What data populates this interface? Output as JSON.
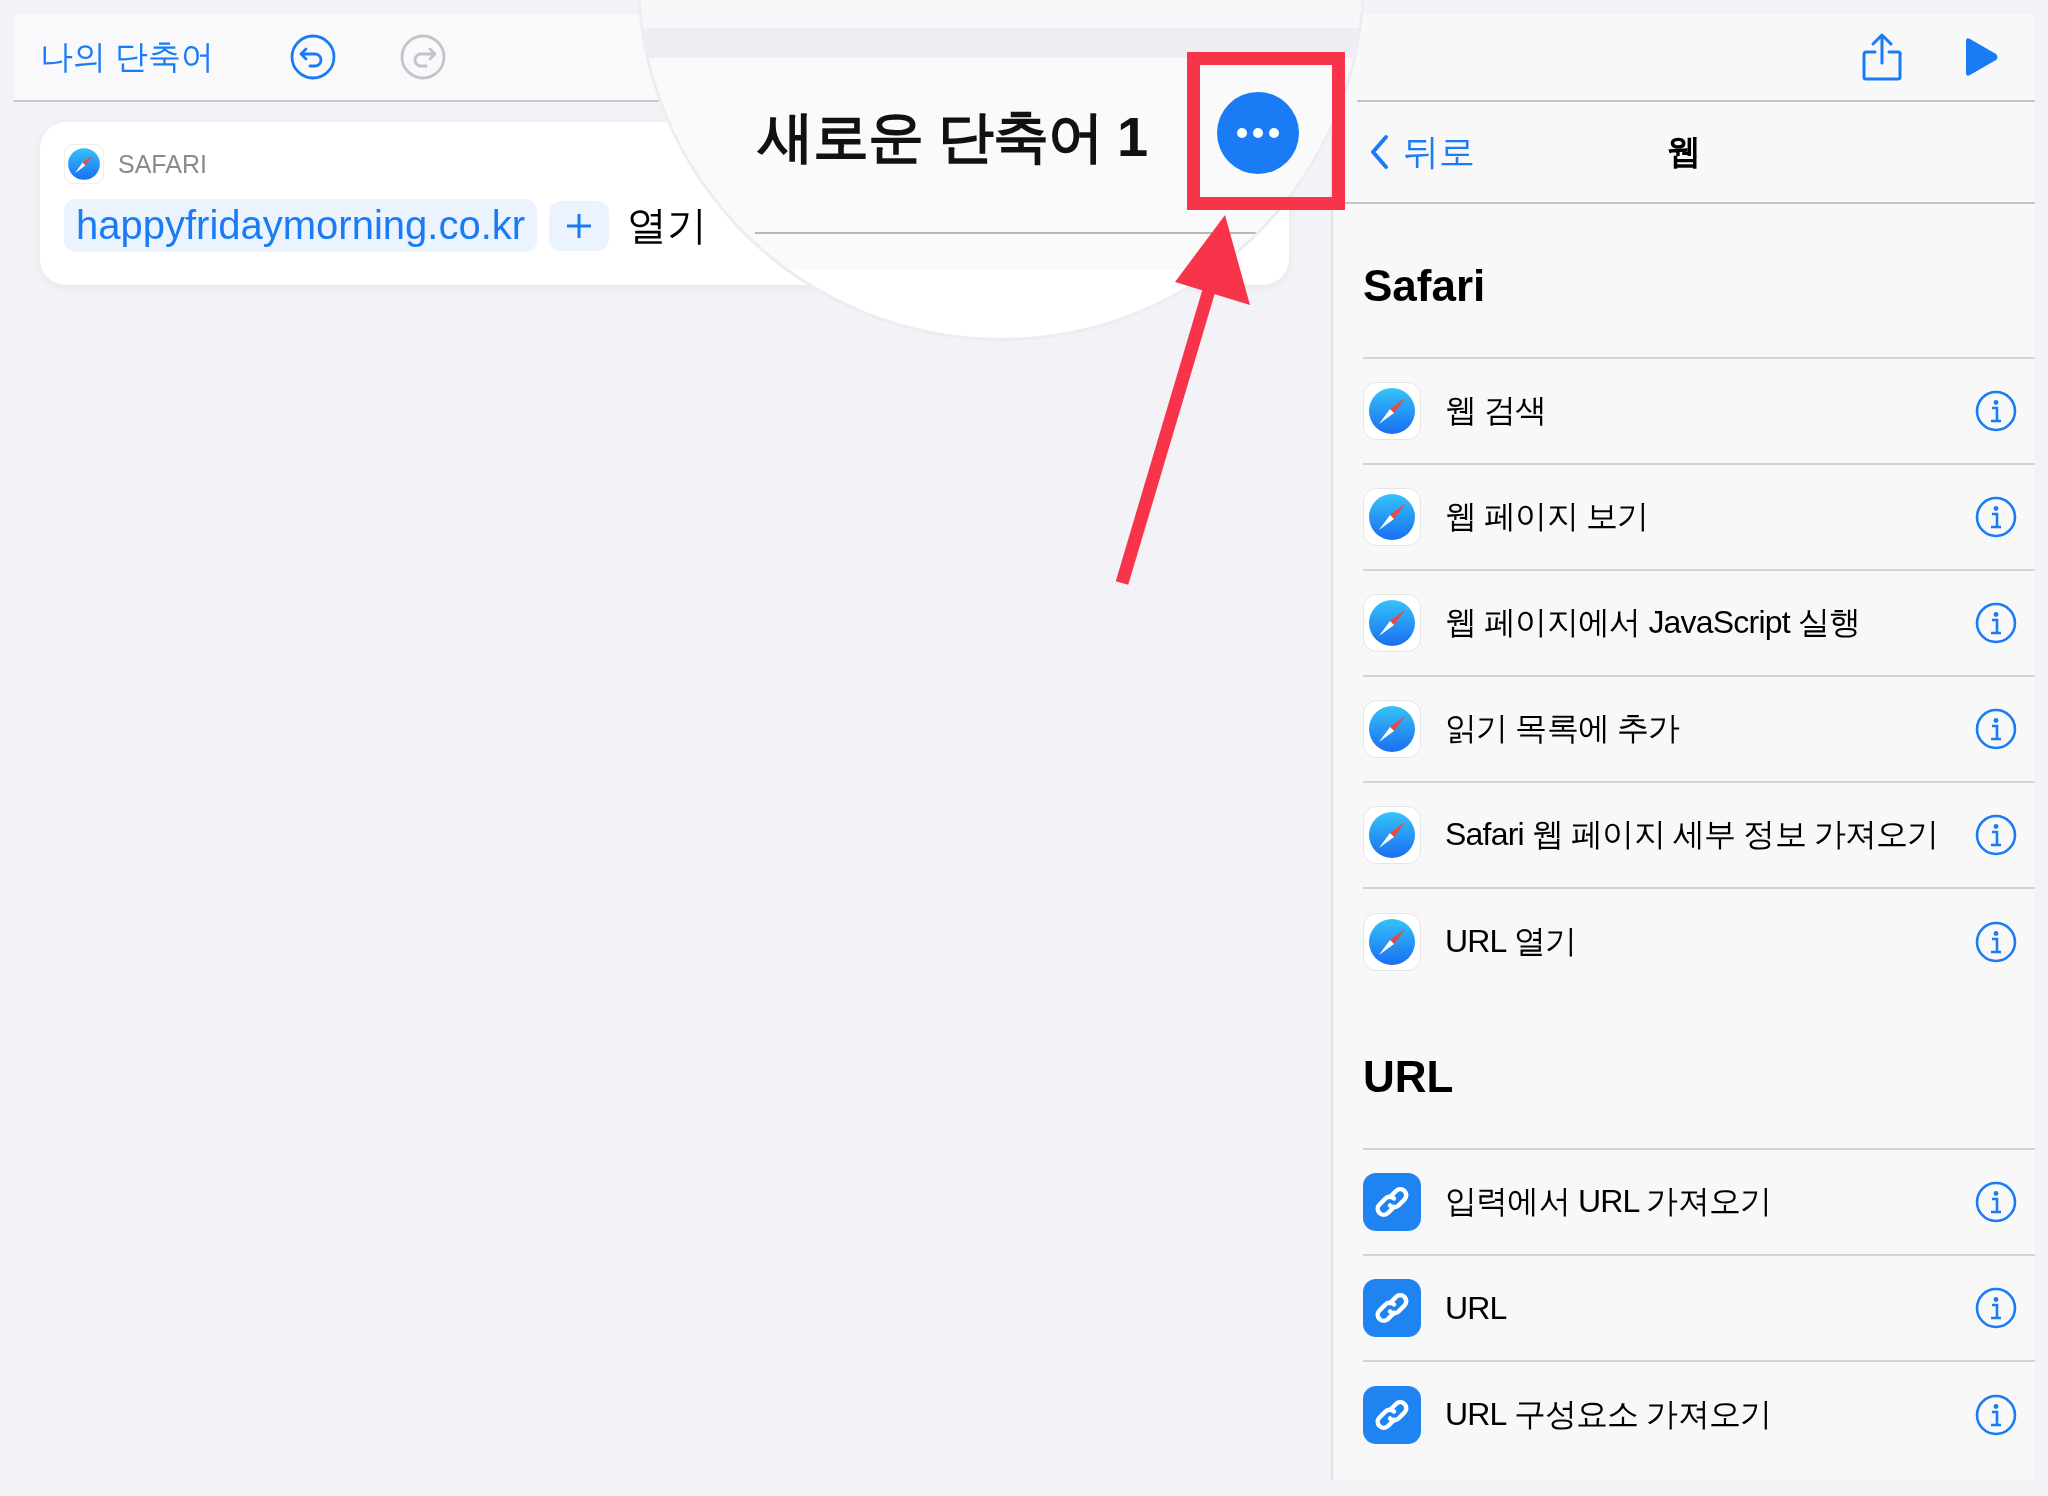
{
  "editor_toolbar": {
    "back_link": "나의 단축어",
    "buttons": [
      {
        "kind": "undo",
        "disabled": false
      },
      {
        "kind": "redo",
        "disabled": true
      }
    ]
  },
  "action_card": {
    "app": "SAFARI",
    "url_token": "happyfridaymorning.co.kr",
    "verb": "열기"
  },
  "magnifier": {
    "title": "새로운 단축어 1"
  },
  "actions_panel": {
    "back": "뒤로",
    "title": "웹",
    "sections": [
      {
        "title": "Safari",
        "items": [
          {
            "label": "웹 검색",
            "kind": "safari"
          },
          {
            "label": "웹 페이지 보기",
            "kind": "safari"
          },
          {
            "label": "웹 페이지에서 JavaScript 실행",
            "kind": "safari"
          },
          {
            "label": "읽기 목록에 추가",
            "kind": "safari"
          },
          {
            "label": "Safari 웹 페이지 세부 정보 가져오기",
            "kind": "safari"
          },
          {
            "label": "URL 열기",
            "kind": "safari"
          }
        ]
      },
      {
        "title": "URL",
        "items": [
          {
            "label": "입력에서 URL 가져오기",
            "kind": "link"
          },
          {
            "label": "URL",
            "kind": "link"
          },
          {
            "label": "URL 구성요소 가져오기",
            "kind": "link"
          }
        ]
      }
    ]
  }
}
